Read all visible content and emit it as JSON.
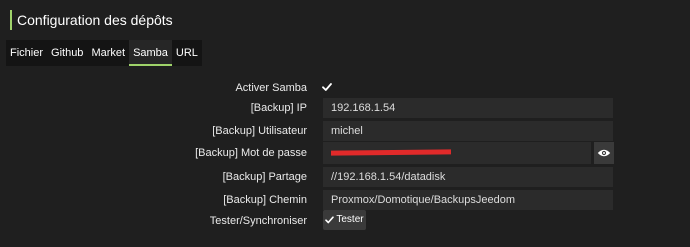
{
  "header": {
    "title": "Configuration des dépôts"
  },
  "tabs": [
    {
      "label": "Fichier"
    },
    {
      "label": "Github"
    },
    {
      "label": "Market"
    },
    {
      "label": "Samba",
      "active": true
    },
    {
      "label": "URL"
    }
  ],
  "form": {
    "activer_samba": {
      "label": "Activer Samba",
      "checked": true
    },
    "ip": {
      "label": "[Backup] IP",
      "value": "192.168.1.54"
    },
    "utilisateur": {
      "label": "[Backup] Utilisateur",
      "value": "michel"
    },
    "mot_de_passe": {
      "label": "[Backup] Mot de passe",
      "redacted": true,
      "reveal_icon": "eye-icon"
    },
    "partage": {
      "label": "[Backup] Partage",
      "value": "//192.168.1.54/datadisk"
    },
    "chemin": {
      "label": "[Backup] Chemin",
      "value": "Proxmox/Domotique/BackupsJeedom"
    },
    "tester": {
      "label": "Tester/Synchroniser",
      "button_label": "Tester",
      "button_icon": "check-icon"
    }
  },
  "colors": {
    "accent": "#9fd36a",
    "redaction": "#e12a2a",
    "background": "#1f1f1f"
  }
}
